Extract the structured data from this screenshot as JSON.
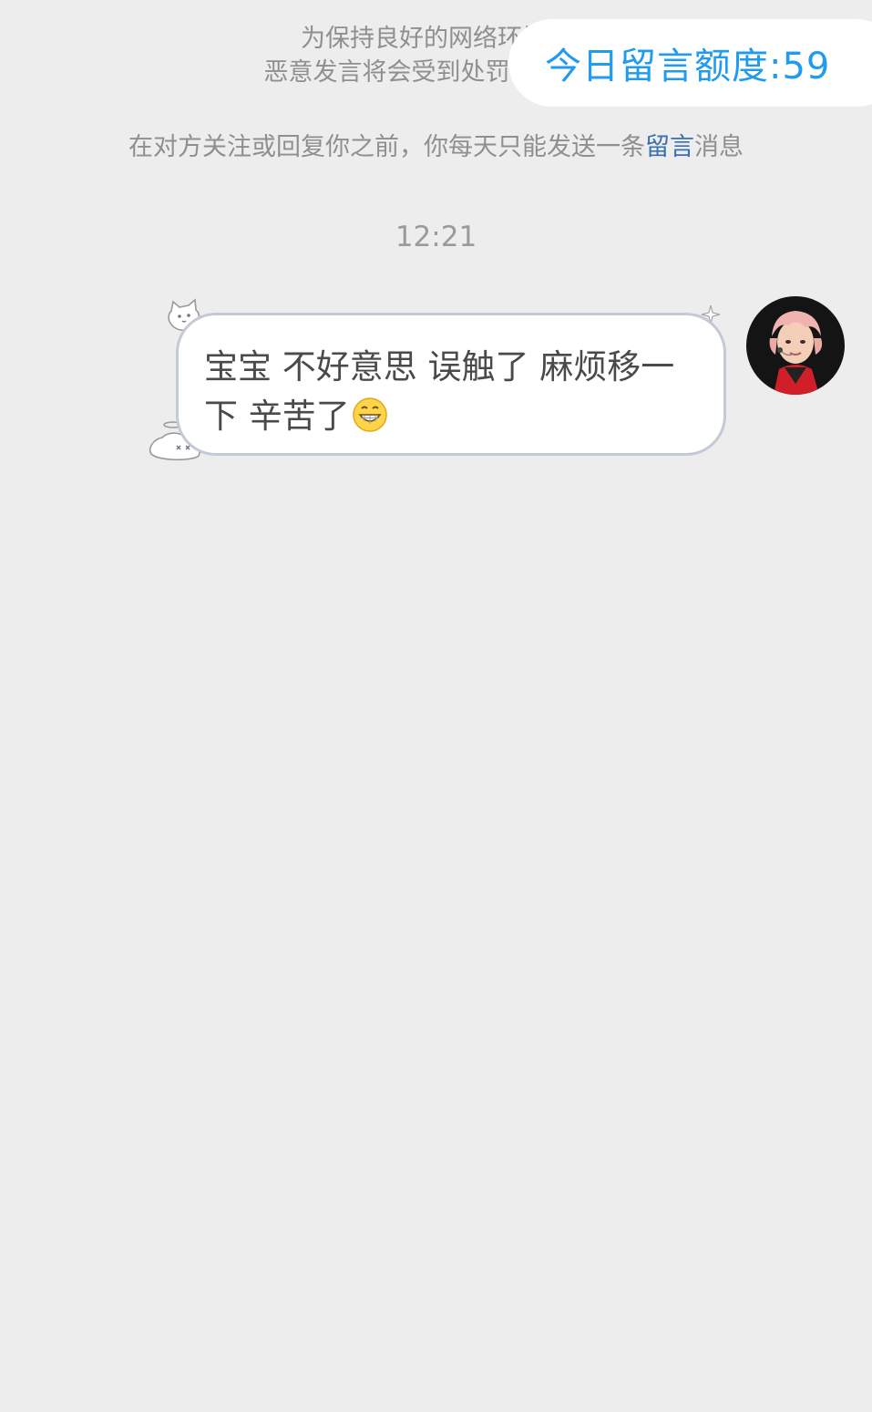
{
  "notice": {
    "line1": "为保持良好的网络环境，",
    "line2": "恶意发言将会受到处罚，详细细",
    "rule_prefix": "在对方关注或回复你之前，你每天只能发送一条",
    "rule_link": "留言",
    "rule_suffix": "消息"
  },
  "quota": {
    "label": "今日留言额度:59"
  },
  "chat": {
    "timestamp": "12:21",
    "messages": [
      {
        "sender": "self",
        "text": "宝宝 不好意思 误触了 麻烦移一下 辛苦了",
        "emoji": "grinning-face-emoji",
        "avatar": "user-avatar"
      }
    ]
  },
  "colors": {
    "background": "#ededed",
    "notice_text": "#8f8f8f",
    "link": "#3a6fb0",
    "quota_text": "#1f9bf0",
    "bubble_border": "#c3cad6",
    "message_text": "#4a4a4a"
  }
}
